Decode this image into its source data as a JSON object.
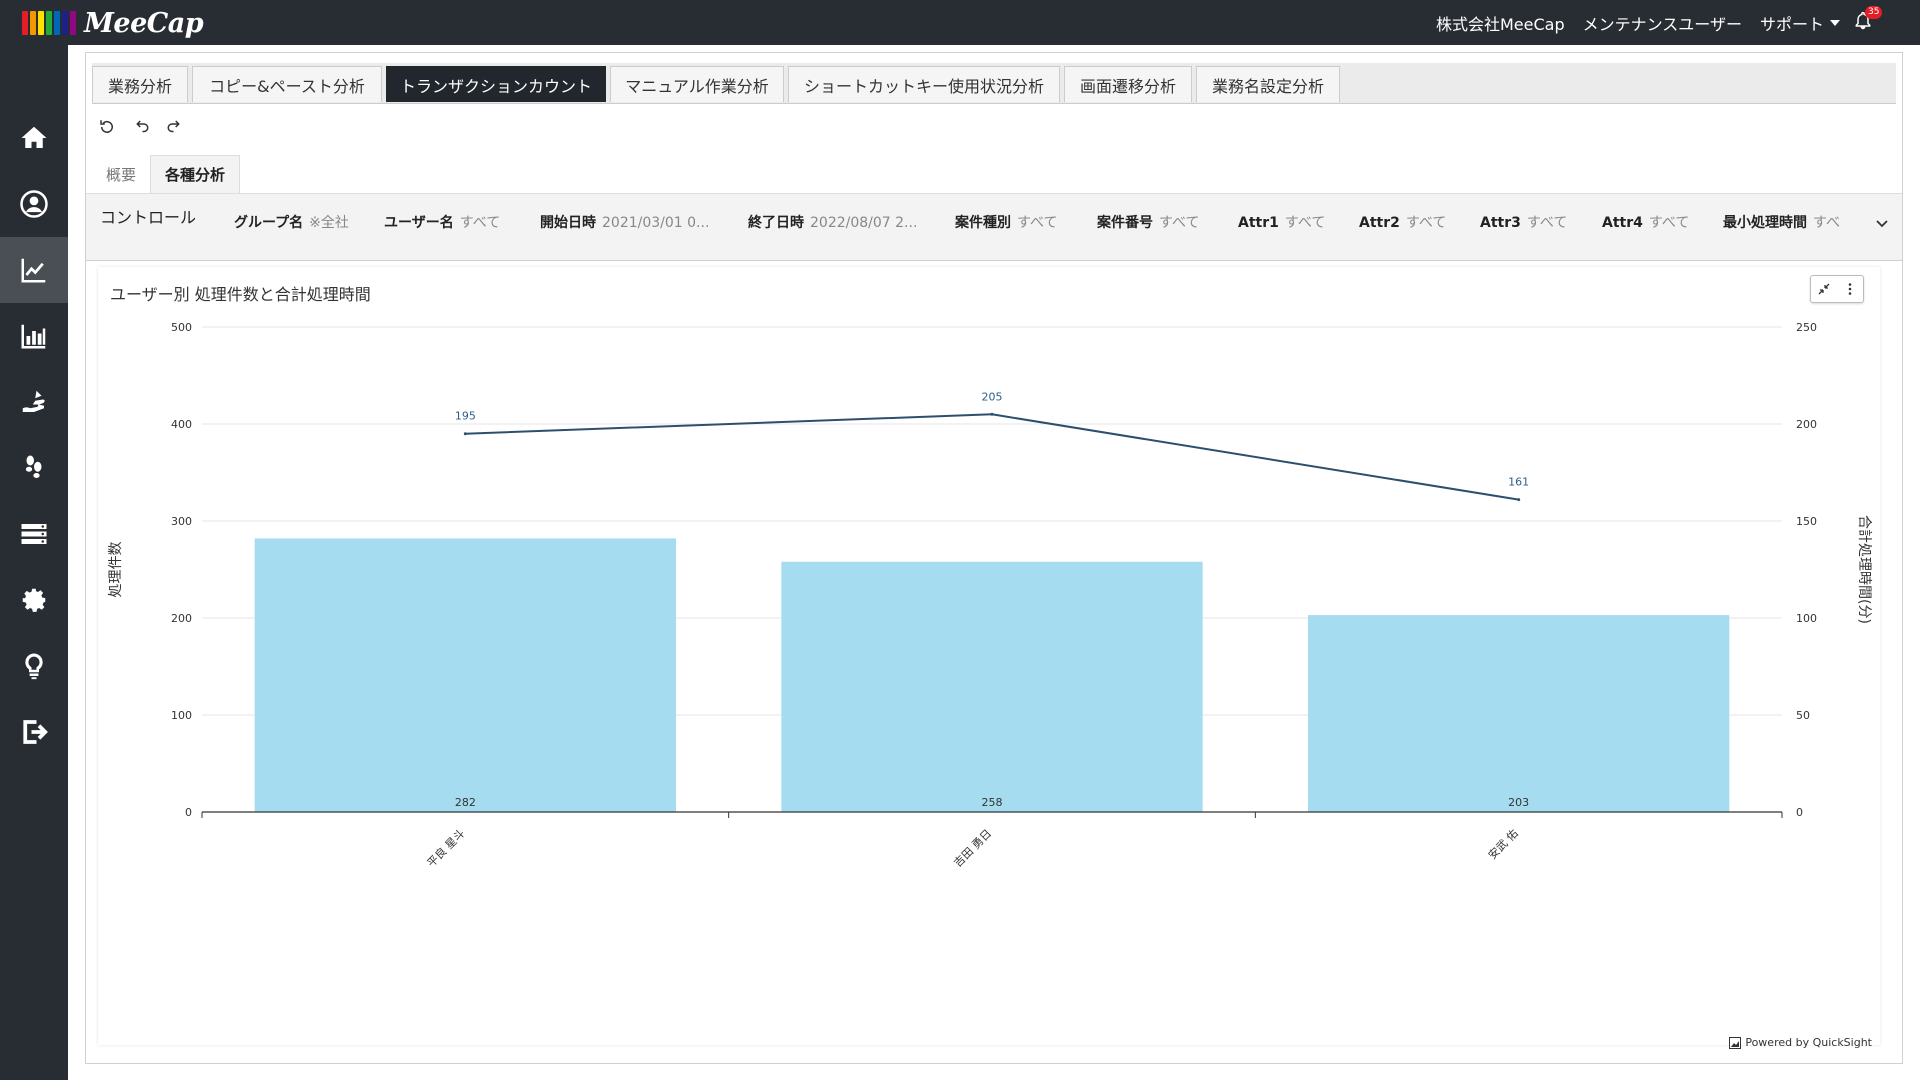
{
  "header": {
    "logo_text": "MeeCap",
    "logo_colors": [
      "#e41e26",
      "#f39800",
      "#ffe100",
      "#22ac38",
      "#0068b7",
      "#1d2088",
      "#920783"
    ],
    "company": "株式会社MeeCap",
    "user": "メンテナンスユーザー",
    "support": "サポート",
    "notification_count": "35"
  },
  "sidebar": {
    "items": [
      {
        "icon": "home-icon"
      },
      {
        "icon": "user-icon"
      },
      {
        "icon": "line-chart-icon",
        "active": true
      },
      {
        "icon": "bar-chart-icon"
      },
      {
        "icon": "hand-icon"
      },
      {
        "icon": "footsteps-icon"
      },
      {
        "icon": "server-icon"
      },
      {
        "icon": "gear-icon"
      },
      {
        "icon": "lightbulb-icon"
      },
      {
        "icon": "logout-icon"
      }
    ]
  },
  "tabs": [
    {
      "label": "業務分析"
    },
    {
      "label": "コピー&ペースト分析"
    },
    {
      "label": "トランザクションカウント",
      "active": true
    },
    {
      "label": "マニュアル作業分析"
    },
    {
      "label": "ショートカットキー使用状況分析"
    },
    {
      "label": "画面遷移分析"
    },
    {
      "label": "業務名設定分析"
    }
  ],
  "subtabs": [
    {
      "label": "概要"
    },
    {
      "label": "各種分析",
      "active": true
    }
  ],
  "controls": {
    "title": "コントロール",
    "items": [
      {
        "label": "グループ名",
        "value": "※全社"
      },
      {
        "label": "ユーザー名",
        "value": "すべて"
      },
      {
        "label": "開始日時",
        "value": "2021/03/01 0..."
      },
      {
        "label": "終了日時",
        "value": "2022/08/07 2..."
      },
      {
        "label": "案件種別",
        "value": "すべて"
      },
      {
        "label": "案件番号",
        "value": "すべて"
      },
      {
        "label": "Attr1",
        "value": "すべて"
      },
      {
        "label": "Attr2",
        "value": "すべて"
      },
      {
        "label": "Attr3",
        "value": "すべて"
      },
      {
        "label": "Attr4",
        "value": "すべて"
      },
      {
        "label": "最小処理時間",
        "value": "すべ"
      }
    ]
  },
  "chart_title": "ユーザー別 処理件数と合計処理時間",
  "powered_by": "Powered by QuickSight",
  "chart_data": {
    "type": "bar",
    "title": "ユーザー別 処理件数と合計処理時間",
    "categories": [
      "平良 星斗",
      "吉田 勇日",
      "安武 佑"
    ],
    "series": [
      {
        "name": "処理件数",
        "type": "bar",
        "axis": "left",
        "values": [
          282,
          258,
          203
        ],
        "color": "#a6dcef"
      },
      {
        "name": "合計処理時間(分)",
        "type": "line",
        "axis": "right",
        "values": [
          195,
          205,
          161
        ],
        "color": "#2d4f6c"
      }
    ],
    "ylabel": "処理件数",
    "y2label": "合計処理時間(分)",
    "ylim": [
      0,
      500
    ],
    "y2lim": [
      0,
      250
    ],
    "yticks": [
      0,
      100,
      200,
      300,
      400,
      500
    ],
    "y2ticks": [
      0,
      50,
      100,
      150,
      200,
      250
    ],
    "grid": true
  }
}
